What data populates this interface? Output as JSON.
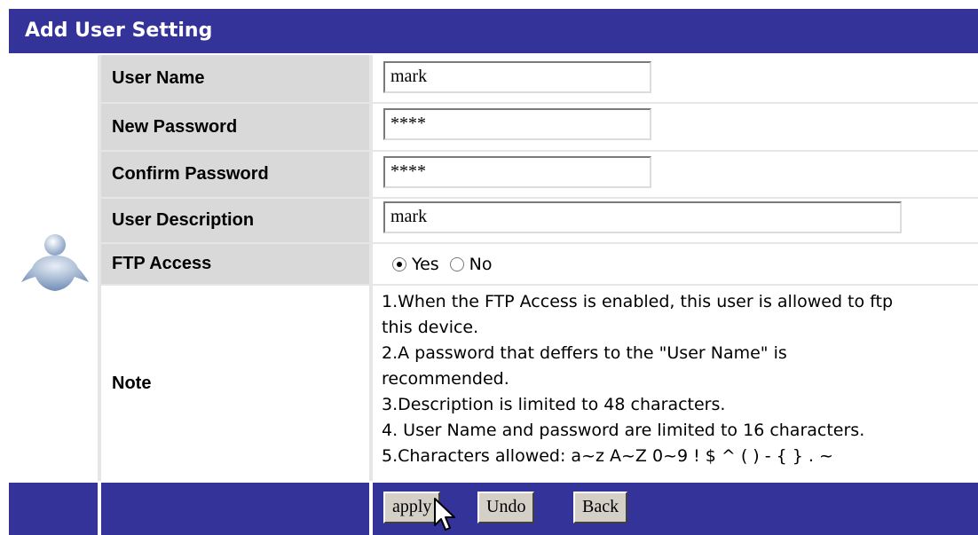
{
  "header": {
    "title": "Add User Setting"
  },
  "form": {
    "user_name": {
      "label": "User Name",
      "value": "mark"
    },
    "new_password": {
      "label": "New Password",
      "value": "****"
    },
    "confirm_password": {
      "label": "Confirm Password",
      "value": "****"
    },
    "user_description": {
      "label": "User Description",
      "value": "mark"
    },
    "ftp_access": {
      "label": "FTP Access",
      "options": [
        "Yes",
        "No"
      ],
      "selected": "Yes"
    },
    "note": {
      "label": "Note",
      "lines": [
        "1.When the FTP Access is enabled, this user is allowed to ftp",
        "this device.",
        "2.A password that deffers to the \"User Name\" is",
        "recommended.",
        "3.Description is limited to 48 characters.",
        "4. User Name and password are limited to 16 characters.",
        "5.Characters allowed: a~z A~Z 0~9 ! $ ^ ( ) - { } . ~"
      ]
    }
  },
  "buttons": {
    "apply": "apply",
    "undo": "Undo",
    "back": "Back"
  },
  "colors": {
    "header_bg": "#333399",
    "label_bg": "#d9d9d9"
  },
  "icons": {
    "avatar": "user-avatar-icon",
    "cursor": "mouse-pointer-icon"
  }
}
